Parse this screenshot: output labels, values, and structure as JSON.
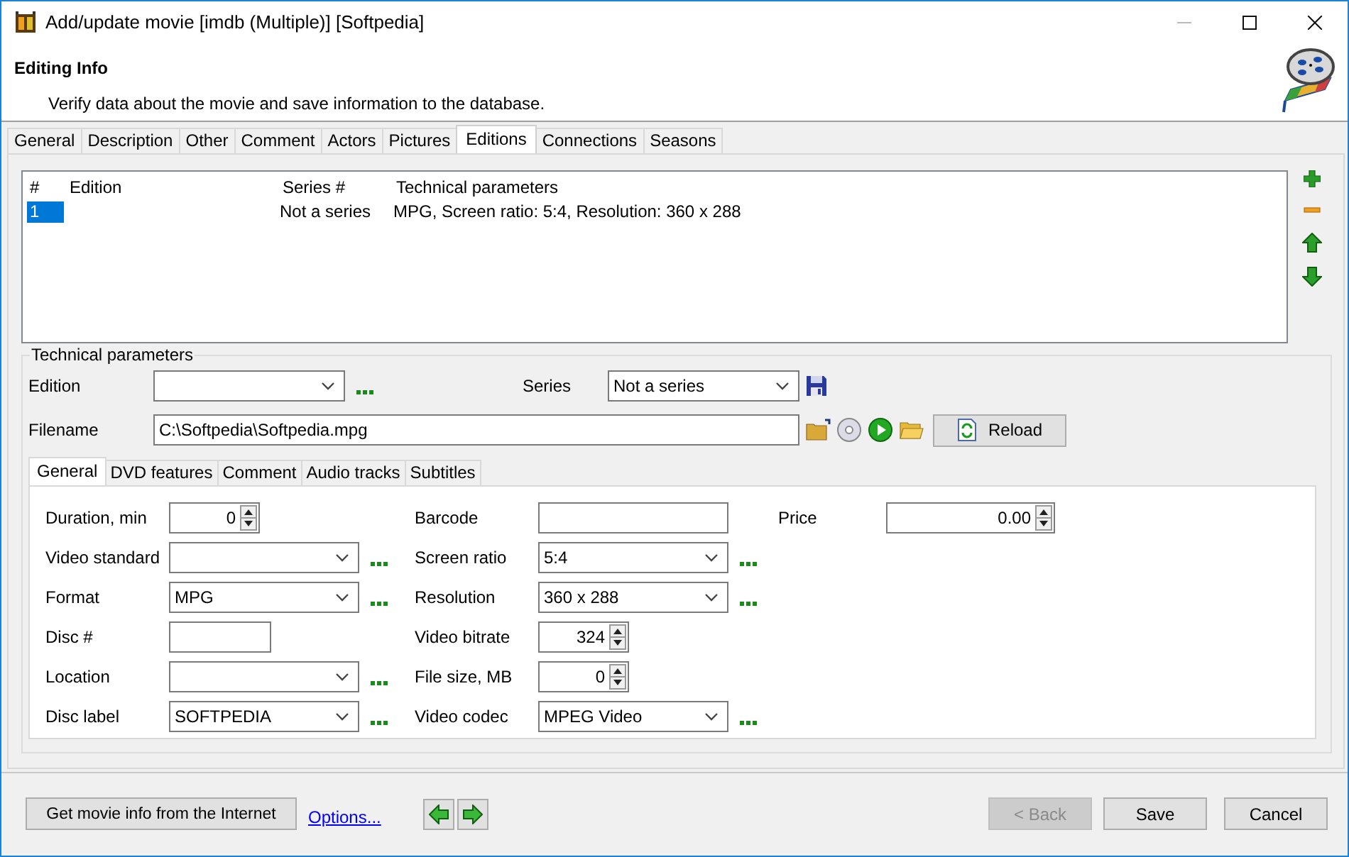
{
  "window": {
    "title": "Add/update movie [imdb (Multiple)] [Softpedia]"
  },
  "header": {
    "title": "Editing Info",
    "subtitle": "Verify data about the movie and save information to the database."
  },
  "tabs": [
    {
      "label": "General",
      "selected": false
    },
    {
      "label": "Description",
      "selected": false
    },
    {
      "label": "Other",
      "selected": false
    },
    {
      "label": "Comment",
      "selected": false
    },
    {
      "label": "Actors",
      "selected": false
    },
    {
      "label": "Pictures",
      "selected": false
    },
    {
      "label": "Editions",
      "selected": true
    },
    {
      "label": "Connections",
      "selected": false
    },
    {
      "label": "Seasons",
      "selected": false
    }
  ],
  "editions_table": {
    "columns": [
      "#",
      "Edition",
      "Series #",
      "Technical parameters"
    ],
    "rows": [
      {
        "number": "1",
        "series": "Not a series",
        "technical_parameters": "MPG, Screen ratio: 5:4, Resolution: 360 x 288",
        "selected": true
      }
    ]
  },
  "technical_parameters": {
    "title": "Technical parameters",
    "edition": {
      "label": "Edition"
    },
    "series": {
      "label": "Series",
      "value": "Not a series"
    },
    "filename": {
      "label": "Filename",
      "value": "C:\\Softpedia\\Softpedia.mpg"
    },
    "reload_button": "Reload",
    "tabs": [
      {
        "label": "General",
        "selected": true
      },
      {
        "label": "DVD features",
        "selected": false
      },
      {
        "label": "Comment",
        "selected": false
      },
      {
        "label": "Audio tracks",
        "selected": false
      },
      {
        "label": "Subtitles",
        "selected": false
      }
    ],
    "columns": [
      [
        {
          "kind": "spin",
          "label": "Duration, min",
          "value": "0"
        },
        {
          "kind": "combo",
          "label": "Video standard"
        },
        {
          "kind": "combo",
          "label": "Format",
          "value": "MPG"
        },
        {
          "kind": "text",
          "label": "Disc #"
        },
        {
          "kind": "combo",
          "label": "Location"
        },
        {
          "kind": "combo",
          "label": "Disc label",
          "value": "SOFTPEDIA"
        }
      ],
      [
        {
          "kind": "text",
          "label": "Barcode"
        },
        {
          "kind": "combo",
          "label": "Screen ratio",
          "value": "5:4"
        },
        {
          "kind": "combo",
          "label": "Resolution",
          "value": "360 x 288"
        },
        {
          "kind": "spin",
          "label": "Video bitrate",
          "value": "324"
        },
        {
          "kind": "spin",
          "label": "File size, MB",
          "value": "0"
        },
        {
          "kind": "combo",
          "label": "Video codec",
          "value": "MPEG Video"
        }
      ],
      [
        {
          "kind": "spin",
          "label": "Price",
          "value": "0.00"
        }
      ]
    ]
  },
  "footer": {
    "internet_button": "Get movie info from the Internet",
    "options_link": "Options...",
    "back_button": {
      "label": "< Back",
      "disabled": true
    },
    "save_button": "Save",
    "cancel_button": "Cancel"
  }
}
